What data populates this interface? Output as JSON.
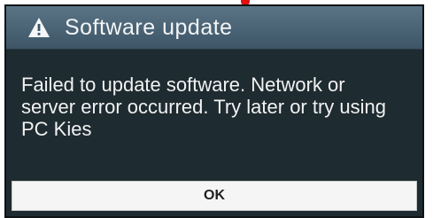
{
  "dialog": {
    "title": "Software update",
    "title_icon": "warning-icon",
    "message": "Failed to update software. Network or server error occurred. Try later or try using PC Kies",
    "ok_label": "OK"
  },
  "colors": {
    "titlebar": "#4a6476",
    "body": "#1e2b30",
    "button": "#f5f5f5",
    "accent_mark": "#e01010"
  }
}
